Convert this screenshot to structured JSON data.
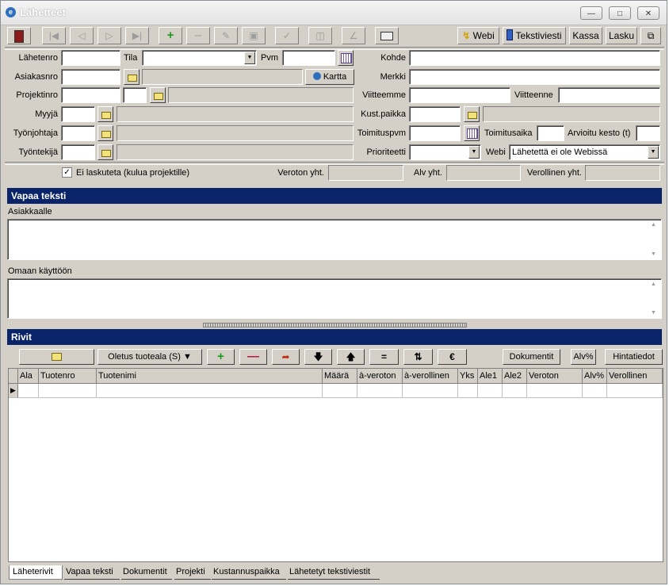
{
  "window": {
    "title": "Lähetteet"
  },
  "toolbar": {
    "webi_label": "Webi",
    "tekstiviesti_label": "Tekstiviesti",
    "kassa_label": "Kassa",
    "lasku_label": "Lasku"
  },
  "form": {
    "lahetenro_label": "Lähetenro",
    "tila_label": "Tila",
    "pvm_label": "Pvm",
    "kohde_label": "Kohde",
    "asiakasnro_label": "Asiakasnro",
    "kartta_label": "Kartta",
    "merkki_label": "Merkki",
    "projektinro_label": "Projektinro",
    "viitteemme_label": "Viitteemme",
    "viitteenne_label": "Viitteenne",
    "myyja_label": "Myyjä",
    "kustpaikka_label": "Kust.paikka",
    "tyonjohtaja_label": "Työnjohtaja",
    "toimituspvm_label": "Toimituspvm",
    "toimitusaika_label": "Toimitusaika",
    "arvioitu_kesto_label": "Arvioitu kesto (t)",
    "tyontekija_label": "Työntekijä",
    "prioriteetti_label": "Prioriteetti",
    "webi_label": "Webi",
    "webi_value": "Lähetettä ei ole Webissä"
  },
  "totals": {
    "ei_laskuteta_label": "Ei laskuteta (kulua projektille)",
    "ei_laskuteta_checked": "✓",
    "veroton_label": "Veroton yht.",
    "alv_label": "Alv yht.",
    "verollinen_label": "Verollinen yht."
  },
  "vapaa": {
    "header": "Vapaa teksti",
    "asiakkaalle_label": "Asiakkaalle",
    "omaan_label": "Omaan käyttöön"
  },
  "rivit": {
    "header": "Rivit",
    "oletus_label": "Oletus tuoteala (S)",
    "dokumentit_label": "Dokumentit",
    "alv_label": "Alv%",
    "hintatiedot_label": "Hintatiedot",
    "columns": [
      "Ala",
      "Tuotenro",
      "Tuotenimi",
      "Määrä",
      "à-veroton",
      "à-verollinen",
      "Yks",
      "Ale1",
      "Ale2",
      "Veroton",
      "Alv%",
      "Verollinen"
    ]
  },
  "tabs": [
    "Läheterivit",
    "Vapaa teksti",
    "Dokumentit",
    "Projekti",
    "Kustannuspaikka",
    "Lähetetyt tekstiviestit"
  ]
}
